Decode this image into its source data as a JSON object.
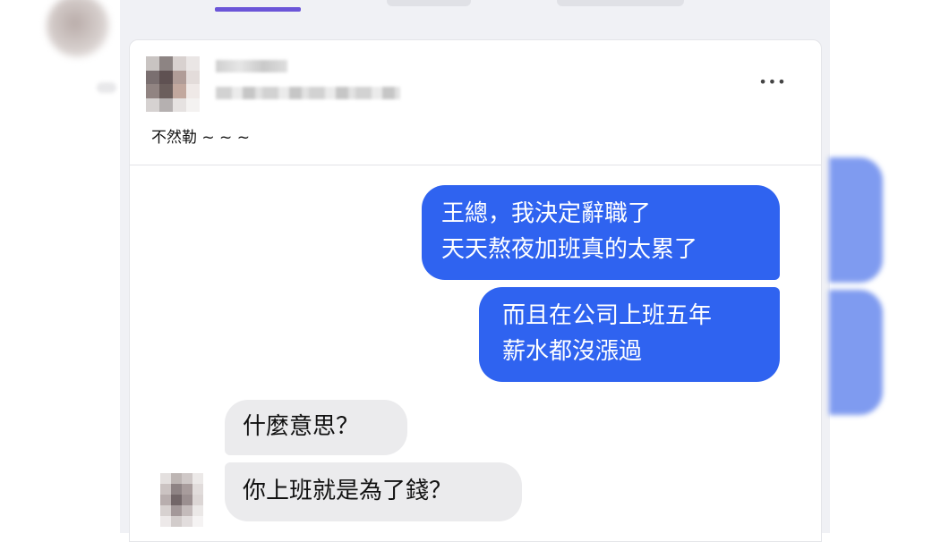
{
  "post": {
    "text": "不然勒 ~ ~ ~",
    "more_label": "•••"
  },
  "chat": {
    "sent_messages": [
      {
        "lines": [
          "王總，我決定辭職了",
          "天天熬夜加班真的太累了"
        ]
      },
      {
        "lines": [
          "而且在公司上班五年",
          "薪水都沒漲過"
        ]
      }
    ],
    "received_messages": [
      {
        "lines": [
          "什麼意思？"
        ]
      },
      {
        "lines": [
          "你上班就是為了錢？"
        ]
      }
    ]
  },
  "colors": {
    "sent_bubble": "#2f63f0",
    "received_bubble": "#ebebed",
    "tab_accent": "#6b55d8"
  }
}
